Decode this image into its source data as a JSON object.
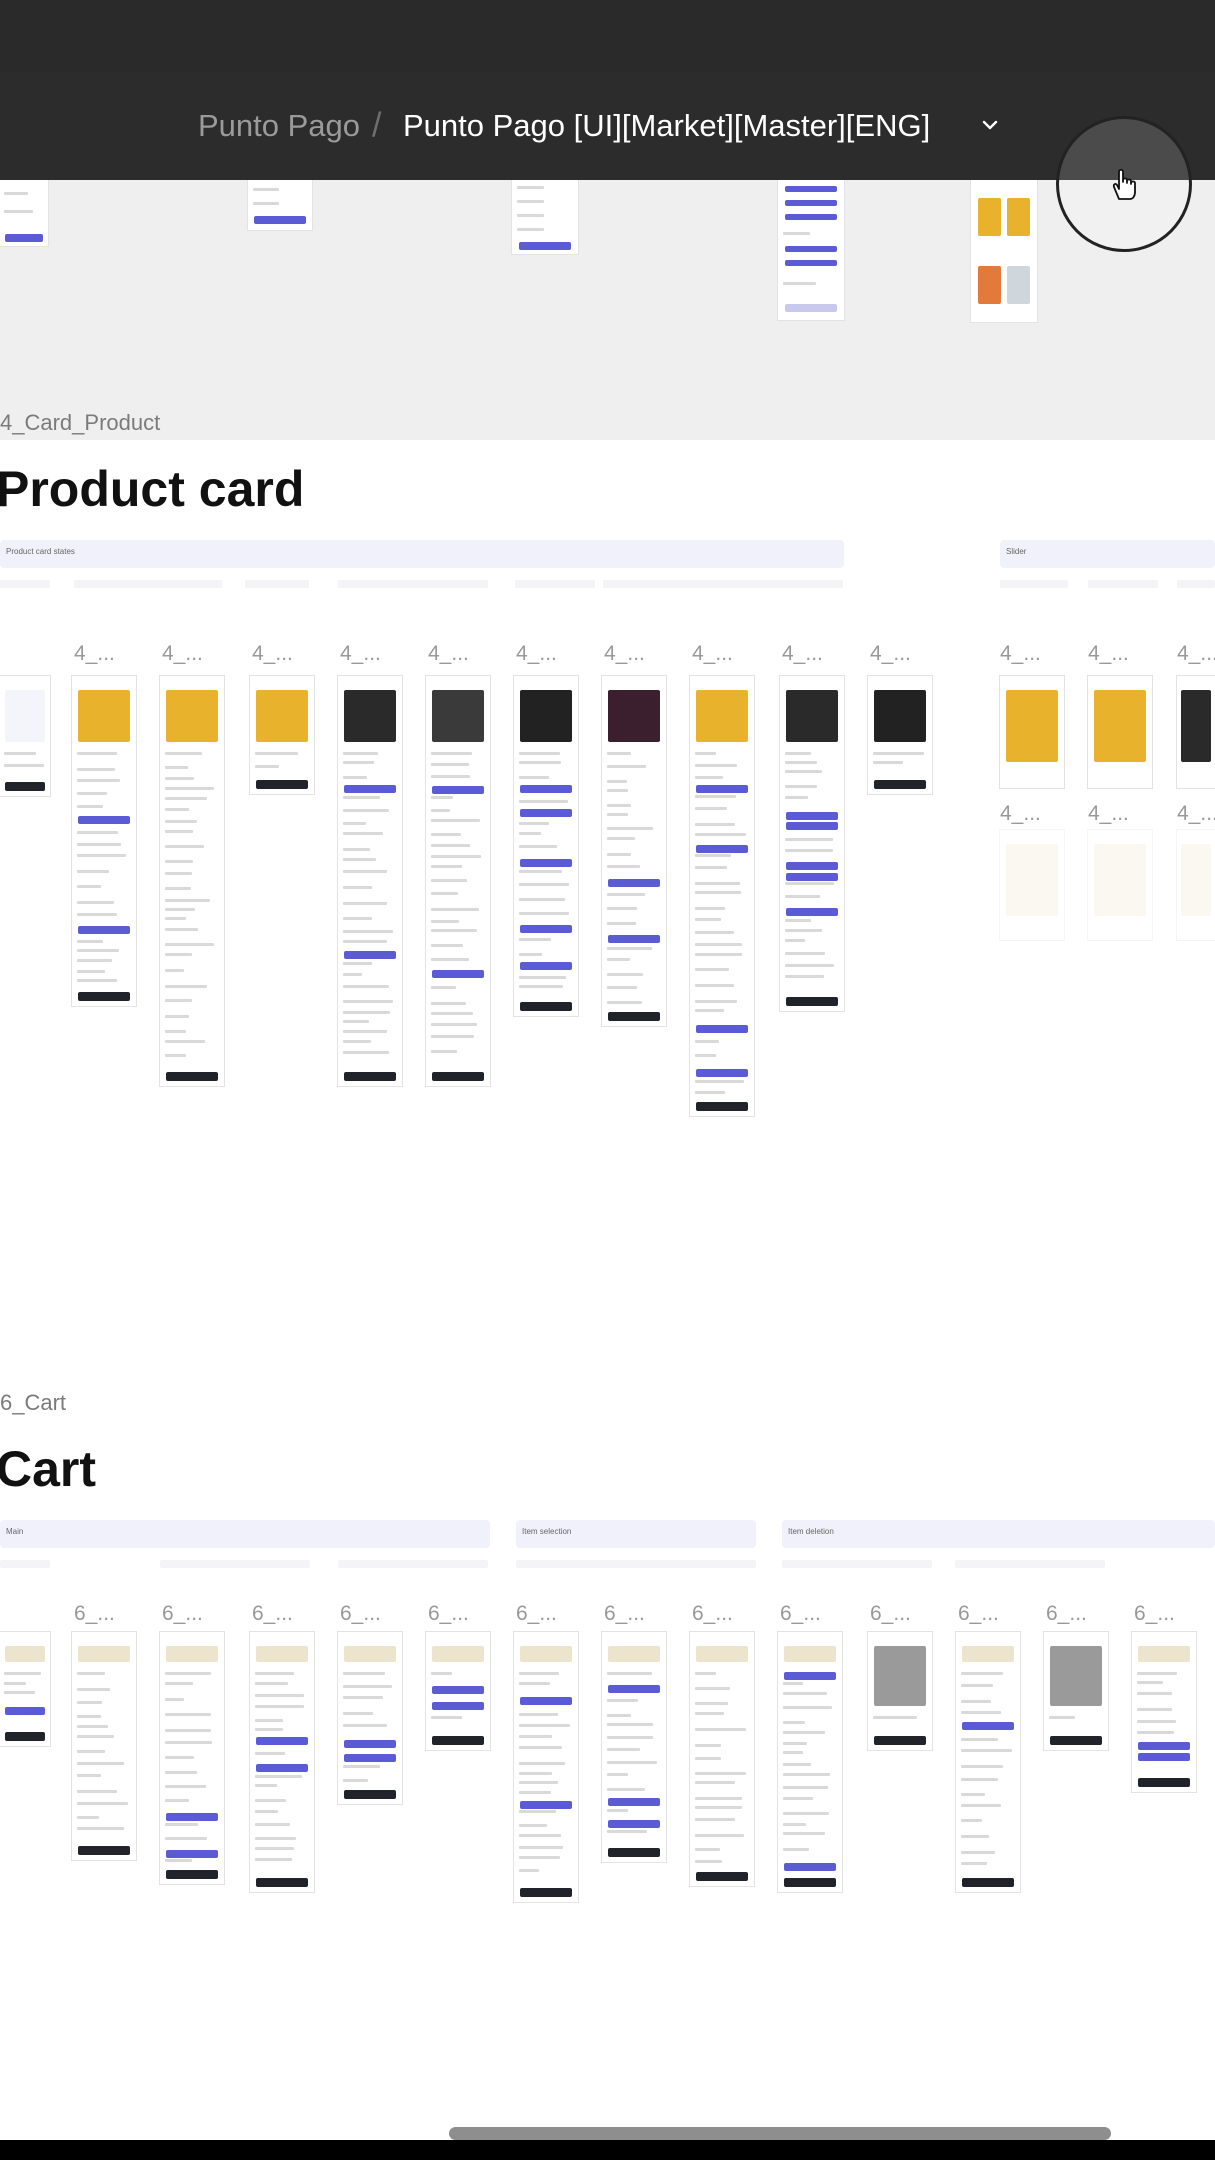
{
  "header": {
    "project": "Punto Pago",
    "separator": "/",
    "file": "Punto Pago [UI][Market][Master][ENG]"
  },
  "sections": {
    "product": {
      "label": "4_Card_Product",
      "title": "Product card",
      "group_states": "Product card states",
      "group_slider": "Slider",
      "frame_label": "4_..."
    },
    "cart": {
      "label": "6_Cart",
      "title": "Cart",
      "group_main": "Main",
      "group_selection": "Item selection",
      "group_deletion": "Item deletion",
      "frame_label": "6_..."
    }
  },
  "colors": {
    "accent": "#5b5bd6",
    "toolbar": "#2c2c2c",
    "canvas": "#efefef",
    "product_yellow": "#e8b22c"
  },
  "icons": [
    "chevron-down-icon",
    "hand-cursor-icon"
  ]
}
